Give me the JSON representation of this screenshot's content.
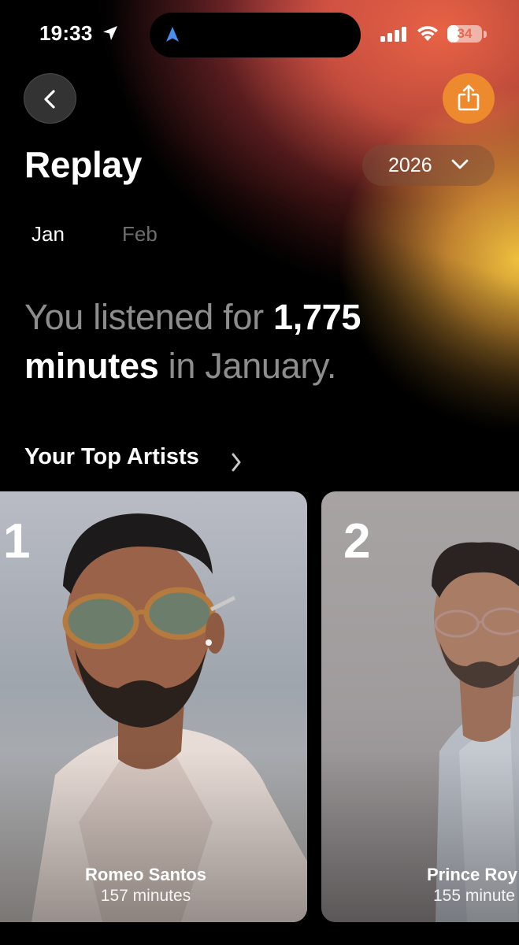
{
  "status_bar": {
    "time": "19:33",
    "battery_percent": "34",
    "battery_level": 0.34,
    "icons": [
      "location-arrow-icon",
      "navigation-icon",
      "cellular-signal-icon",
      "wifi-icon",
      "battery-icon"
    ]
  },
  "header": {
    "back_icon": "chevron-left-icon",
    "share_icon": "share-icon",
    "title": "Replay",
    "year": "2026",
    "year_icon": "chevron-down-icon"
  },
  "months": [
    {
      "label": "Jan",
      "selected": true
    },
    {
      "label": "Feb",
      "selected": false
    }
  ],
  "summary": {
    "part1": "You listened for ",
    "minutes": "1,775",
    "unit": "minutes",
    "part2": " in January."
  },
  "top_artists": {
    "title": "Your Top Artists",
    "items": [
      {
        "rank": "1",
        "name": "Romeo Santos",
        "minutes": "157 minutes"
      },
      {
        "rank": "2",
        "name": "Prince Roy",
        "minutes": "155 minute"
      }
    ]
  },
  "colors": {
    "share_button": "#ee8a2e",
    "glow_orange": "#ec6446",
    "glow_yellow": "#f3c43f",
    "dim_text": "#8d8d8d"
  }
}
